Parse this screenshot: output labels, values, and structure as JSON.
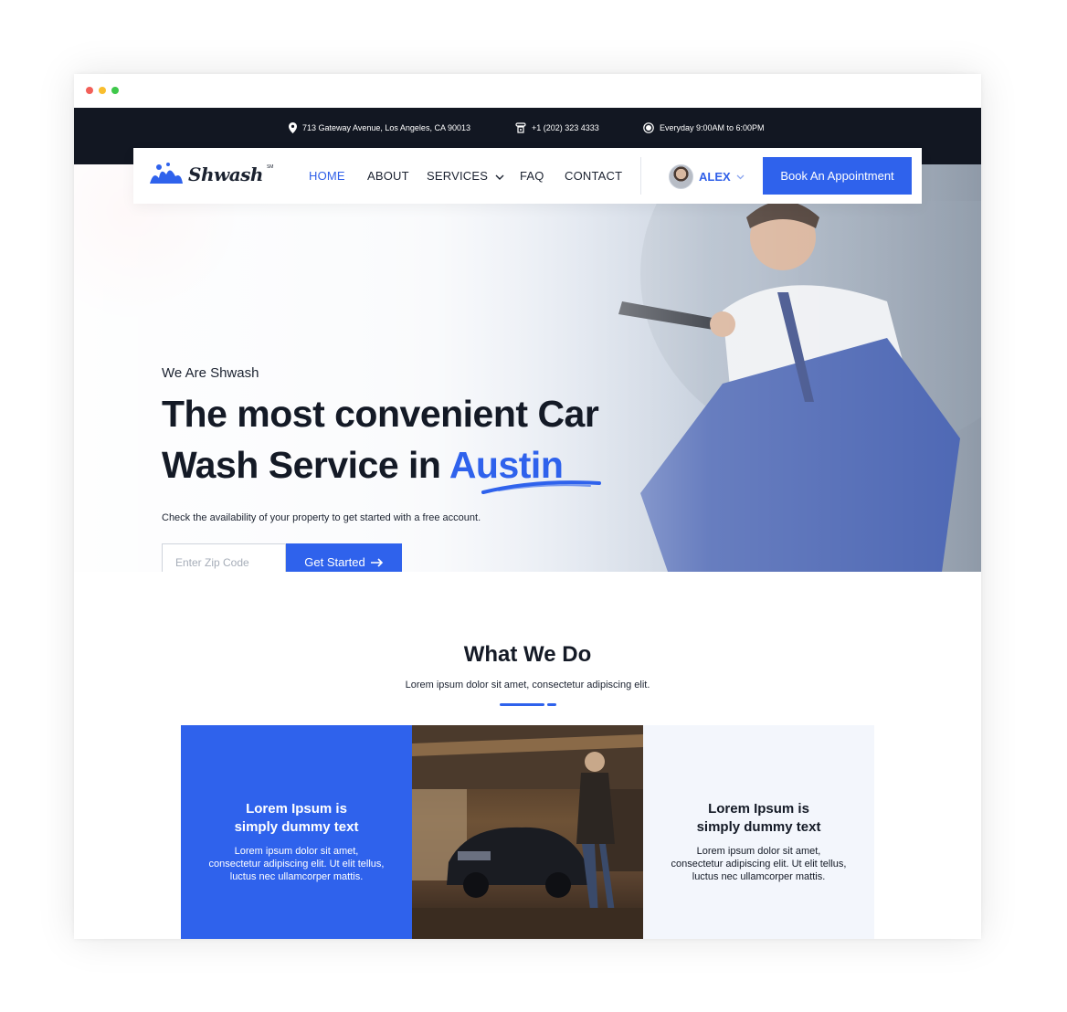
{
  "topbar": {
    "address": "713 Gateway Avenue, Los Angeles, CA 90013",
    "phone": "+1 (202) 323 4333",
    "hours": "Everyday 9:00AM to 6:00PM"
  },
  "nav": {
    "logo": "Shwash",
    "logo_mark": "SM",
    "links": [
      "HOME",
      "ABOUT",
      "SERVICES",
      "FAQ",
      "CONTACT"
    ],
    "active": "HOME",
    "user": "ALEX",
    "cta": "Book An Appointment"
  },
  "hero": {
    "eyebrow": "We Are Shwash",
    "title_line1": "The most convenient Car",
    "title_line2": "Wash Service in ",
    "title_accent": "Austin",
    "description": "Check the availability of your property to get started with a free account.",
    "zip_placeholder": "Enter Zip Code",
    "button": "Get Started"
  },
  "services": {
    "title": "What We Do",
    "subtitle": "Lorem ipsum dolor sit amet, consectetur adipiscing elit.",
    "cards": [
      {
        "title_line1": "Lorem Ipsum is",
        "title_line2": "simply dummy text",
        "text_line1": "Lorem ipsum dolor sit amet,",
        "text_line2": "consectetur adipiscing elit. Ut elit tellus,",
        "text_line3": "luctus nec ullamcorper mattis."
      },
      {
        "title_line1": "Lorem Ipsum is",
        "title_line2": "simply dummy text",
        "text_line1": "Lorem ipsum dolor sit amet,",
        "text_line2": "consectetur adipiscing elit. Ut elit tellus,",
        "text_line3": "luctus nec ullamcorper mattis."
      }
    ]
  },
  "colors": {
    "accent": "#2f62ec",
    "topbar": "#121722",
    "text": "#141a26"
  }
}
